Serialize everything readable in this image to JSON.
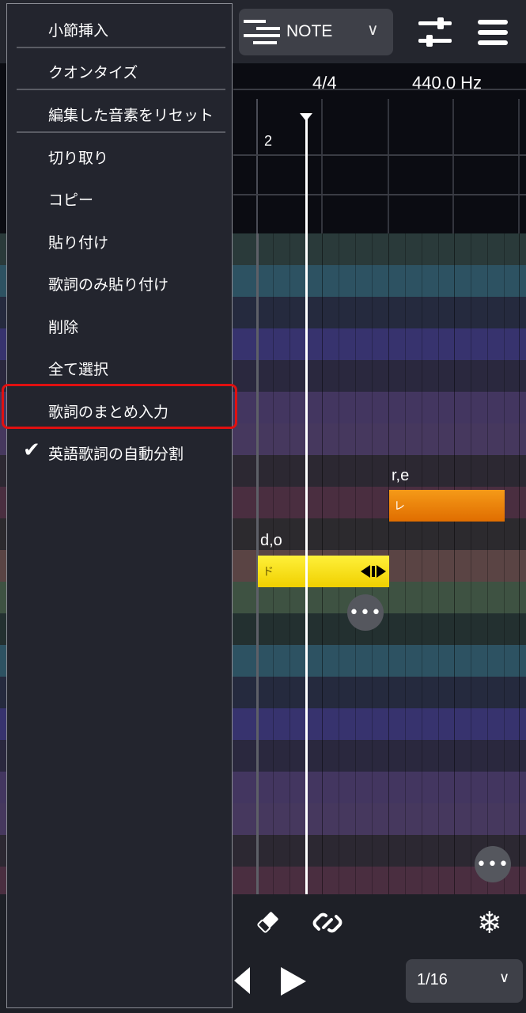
{
  "toolbar": {
    "mode_label": "NOTE",
    "mode_chevron": "chevron-down-icon",
    "mixer_icon": "mixer-icon",
    "menu_icon": "hamburger-menu-icon"
  },
  "ruler": {
    "time_signature": "4/4",
    "tuning": "440.0 Hz",
    "measure_number": "2"
  },
  "notes": [
    {
      "lyric_label": "r,e",
      "text": "レ",
      "color": "#f08c10"
    },
    {
      "lyric_label": "d,o",
      "text": "ド",
      "color": "#f5e000",
      "resize_icon": "resize-arrows-icon"
    }
  ],
  "bottom": {
    "quantize_value": "1/16"
  },
  "menu": {
    "items": [
      {
        "label": "小節挿入"
      },
      {
        "label": "クオンタイズ"
      },
      {
        "label": "編集した音素をリセット"
      },
      {
        "label": "切り取り"
      },
      {
        "label": "コピー"
      },
      {
        "label": "貼り付け"
      },
      {
        "label": "歌詞のみ貼り付け"
      },
      {
        "label": "削除"
      },
      {
        "label": "全て選択"
      },
      {
        "label": "歌詞のまとめ入力"
      },
      {
        "label": "英語歌詞の自動分割",
        "checked": true
      }
    ]
  },
  "colors": {
    "highlight": "#e01010",
    "menu_bg": "#23252e"
  }
}
